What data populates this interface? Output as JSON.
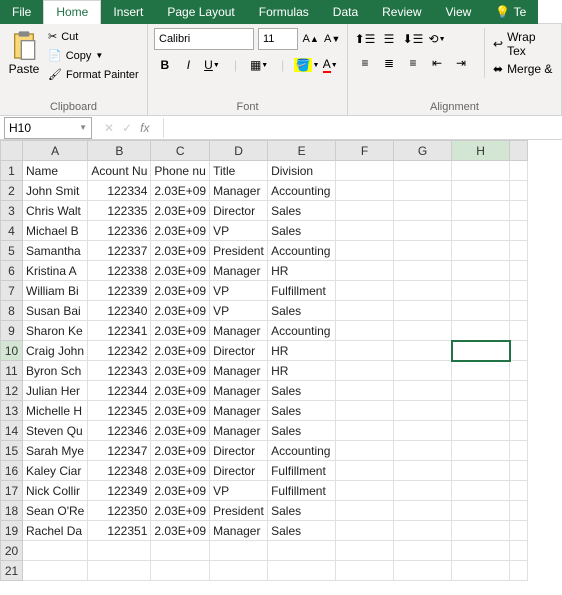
{
  "tabs": {
    "file": "File",
    "home": "Home",
    "insert": "Insert",
    "pagelayout": "Page Layout",
    "formulas": "Formulas",
    "data": "Data",
    "review": "Review",
    "view": "View",
    "tell": "Te"
  },
  "ribbon": {
    "clipboard": {
      "paste": "Paste",
      "cut": "Cut",
      "copy": "Copy",
      "format_painter": "Format Painter",
      "label": "Clipboard"
    },
    "font": {
      "name": "Calibri",
      "size": "11",
      "label": "Font"
    },
    "alignment": {
      "wrap": "Wrap Tex",
      "merge": "Merge &",
      "label": "Alignment"
    }
  },
  "namebox": "H10",
  "columns": [
    "A",
    "B",
    "C",
    "D",
    "E",
    "F",
    "G",
    "H"
  ],
  "headers": [
    "Name",
    "Acount Nu",
    "Phone nu",
    "Title",
    "Division"
  ],
  "rows": [
    {
      "n": "John Smit",
      "a": "122334",
      "p": "2.03E+09",
      "t": "Manager",
      "d": "Accounting"
    },
    {
      "n": "Chris Walt",
      "a": "122335",
      "p": "2.03E+09",
      "t": "Director",
      "d": "Sales"
    },
    {
      "n": "Michael B",
      "a": "122336",
      "p": "2.03E+09",
      "t": "VP",
      "d": "Sales"
    },
    {
      "n": "Samantha",
      "a": "122337",
      "p": "2.03E+09",
      "t": "President",
      "d": "Accounting"
    },
    {
      "n": "Kristina A",
      "a": "122338",
      "p": "2.03E+09",
      "t": "Manager",
      "d": "HR"
    },
    {
      "n": "William Bi",
      "a": "122339",
      "p": "2.03E+09",
      "t": "VP",
      "d": "Fulfillment"
    },
    {
      "n": "Susan Bai",
      "a": "122340",
      "p": "2.03E+09",
      "t": "VP",
      "d": "Sales"
    },
    {
      "n": "Sharon Ke",
      "a": "122341",
      "p": "2.03E+09",
      "t": "Manager",
      "d": "Accounting"
    },
    {
      "n": "Craig John",
      "a": "122342",
      "p": "2.03E+09",
      "t": "Director",
      "d": "HR"
    },
    {
      "n": "Byron Sch",
      "a": "122343",
      "p": "2.03E+09",
      "t": "Manager",
      "d": "HR"
    },
    {
      "n": "Julian Her",
      "a": "122344",
      "p": "2.03E+09",
      "t": "Manager",
      "d": "Sales"
    },
    {
      "n": "Michelle H",
      "a": "122345",
      "p": "2.03E+09",
      "t": "Manager",
      "d": "Sales"
    },
    {
      "n": "Steven Qu",
      "a": "122346",
      "p": "2.03E+09",
      "t": "Manager",
      "d": "Sales"
    },
    {
      "n": "Sarah Mye",
      "a": "122347",
      "p": "2.03E+09",
      "t": "Director",
      "d": "Accounting"
    },
    {
      "n": "Kaley Ciar",
      "a": "122348",
      "p": "2.03E+09",
      "t": "Director",
      "d": "Fulfillment"
    },
    {
      "n": "Nick Collir",
      "a": "122349",
      "p": "2.03E+09",
      "t": "VP",
      "d": "Fulfillment"
    },
    {
      "n": "Sean O'Re",
      "a": "122350",
      "p": "2.03E+09",
      "t": "President",
      "d": "Sales"
    },
    {
      "n": "Rachel Da",
      "a": "122351",
      "p": "2.03E+09",
      "t": "Manager",
      "d": "Sales"
    }
  ],
  "selected": {
    "row": 10,
    "col": "H"
  }
}
